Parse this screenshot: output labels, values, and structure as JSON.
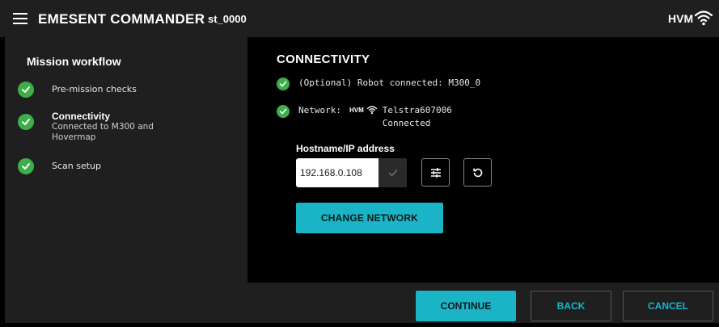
{
  "header": {
    "app_title": "EMESENT COMMANDER",
    "session_id": "st_0000",
    "device_label": "HVM"
  },
  "sidebar": {
    "title": "Mission workflow",
    "steps": [
      {
        "title": "Pre-mission checks",
        "status": "complete"
      },
      {
        "title": "Connectivity",
        "sub": "Connected to M300 and Hovermap",
        "status": "complete"
      },
      {
        "title": "Scan setup",
        "status": "complete"
      }
    ]
  },
  "main": {
    "title": "CONNECTIVITY",
    "robot_status": "(Optional) Robot connected: M300_0",
    "network_label": "Network:",
    "network_device": "HVM",
    "network_name": "Telstra607006",
    "network_state": "Connected",
    "host_label": "Hostname/IP address",
    "host_value": "192.168.0.108",
    "change_network_label": "CHANGE NETWORK"
  },
  "footer": {
    "continue_label": "CONTINUE",
    "back_label": "BACK",
    "cancel_label": "CANCEL"
  },
  "colors": {
    "accent": "#1bb4c6",
    "success": "#3dae49",
    "panel": "#1f1f1f",
    "background": "#000000"
  },
  "icons": [
    "menu-icon",
    "wifi-icon",
    "check-icon",
    "settings-sliders-icon",
    "refresh-icon"
  ]
}
